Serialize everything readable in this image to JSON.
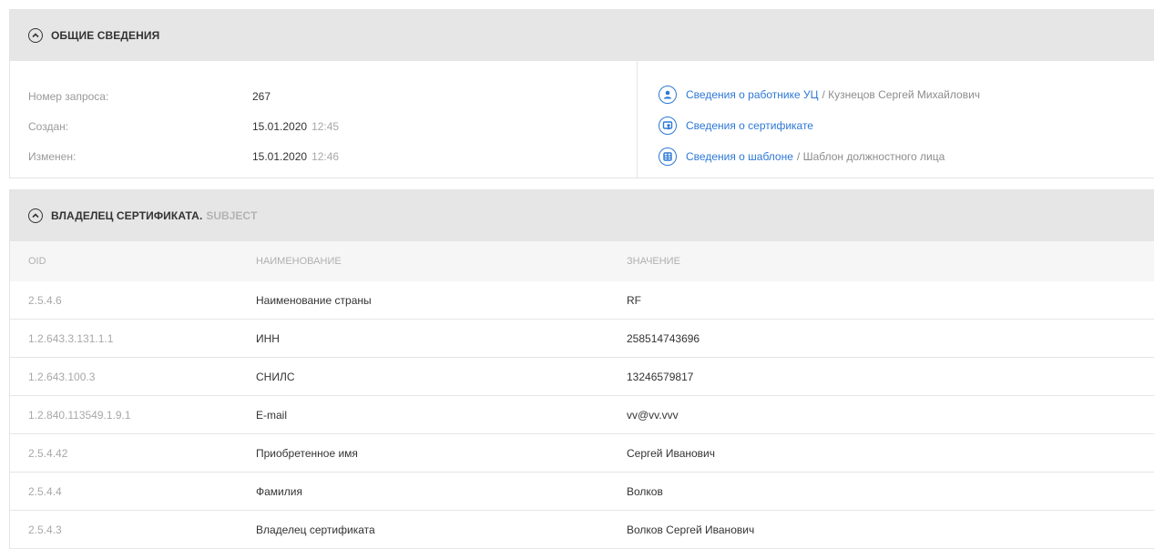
{
  "general": {
    "title": "Общие сведения",
    "fields": [
      {
        "label": "Номер запроса:",
        "value": "267",
        "time": ""
      },
      {
        "label": "Создан:",
        "value": "15.01.2020",
        "time": "12:45"
      },
      {
        "label": "Изменен:",
        "value": "15.01.2020",
        "time": "12:46"
      }
    ],
    "links": [
      {
        "icon": "user-icon",
        "text": "Сведения о работнике УЦ",
        "extra": "/ Кузнецов Сергей Михайлович"
      },
      {
        "icon": "certificate-icon",
        "text": "Сведения о сертификате",
        "extra": ""
      },
      {
        "icon": "template-icon",
        "text": "Сведения о шаблоне",
        "extra": "/ Шаблон должностного лица"
      }
    ]
  },
  "subject": {
    "title": "Владелец сертификата.",
    "subtitle": "Subject",
    "columns": {
      "oid": "OID",
      "name": "Наименование",
      "value": "Значение"
    },
    "rows": [
      {
        "oid": "2.5.4.6",
        "name": "Наименование страны",
        "value": "RF"
      },
      {
        "oid": "1.2.643.3.131.1.1",
        "name": "ИНН",
        "value": "258514743696"
      },
      {
        "oid": "1.2.643.100.3",
        "name": "СНИЛС",
        "value": "13246579817"
      },
      {
        "oid": "1.2.840.113549.1.9.1",
        "name": "E-mail",
        "value": "vv@vv.vvv"
      },
      {
        "oid": "2.5.4.42",
        "name": "Приобретенное имя",
        "value": "Сергей Иванович"
      },
      {
        "oid": "2.5.4.4",
        "name": "Фамилия",
        "value": "Волков"
      },
      {
        "oid": "2.5.4.3",
        "name": "Владелец сертификата",
        "value": "Волков Сергей Иванович"
      }
    ]
  },
  "colors": {
    "accent": "#2d78d6",
    "header_bg": "#e6e6e6"
  }
}
